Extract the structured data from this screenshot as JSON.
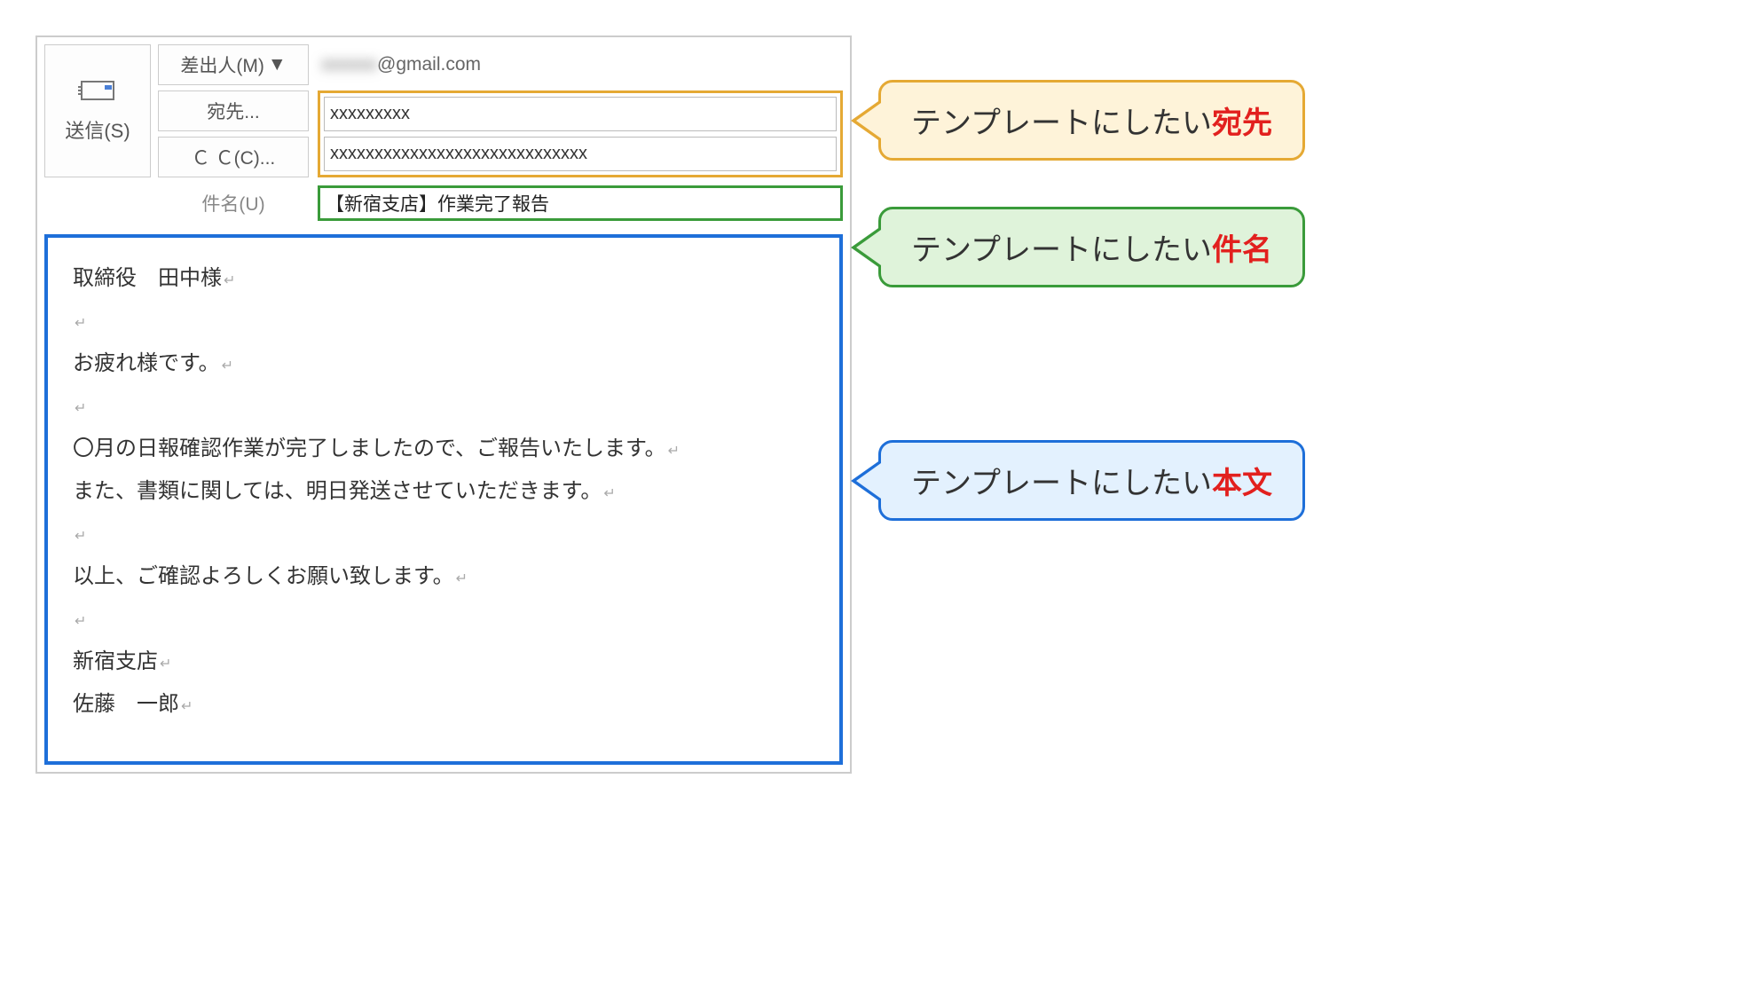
{
  "send": {
    "label": "送信(S)"
  },
  "from": {
    "label": "差出人(M)",
    "value": "@gmail.com"
  },
  "to": {
    "label": "宛先..."
  },
  "cc": {
    "label": "Ｃ Ｃ(C)..."
  },
  "subject": {
    "label": "件名(U)",
    "value": "【新宿支店】作業完了報告"
  },
  "body": {
    "lines": [
      "取締役　田中様",
      "",
      "お疲れ様です。",
      "",
      "〇月の日報確認作業が完了しましたので、ご報告いたします。",
      "また、書類に関しては、明日発送させていただきます。",
      "",
      "以上、ご確認よろしくお願い致します。",
      "",
      "新宿支店",
      "佐藤　一郎"
    ]
  },
  "callouts": {
    "to_prefix": "テンプレートにしたい",
    "to_em": "宛先",
    "subject_prefix": "テンプレートにしたい",
    "subject_em": "件名",
    "body_prefix": "テンプレートにしたい",
    "body_em": "本文"
  }
}
